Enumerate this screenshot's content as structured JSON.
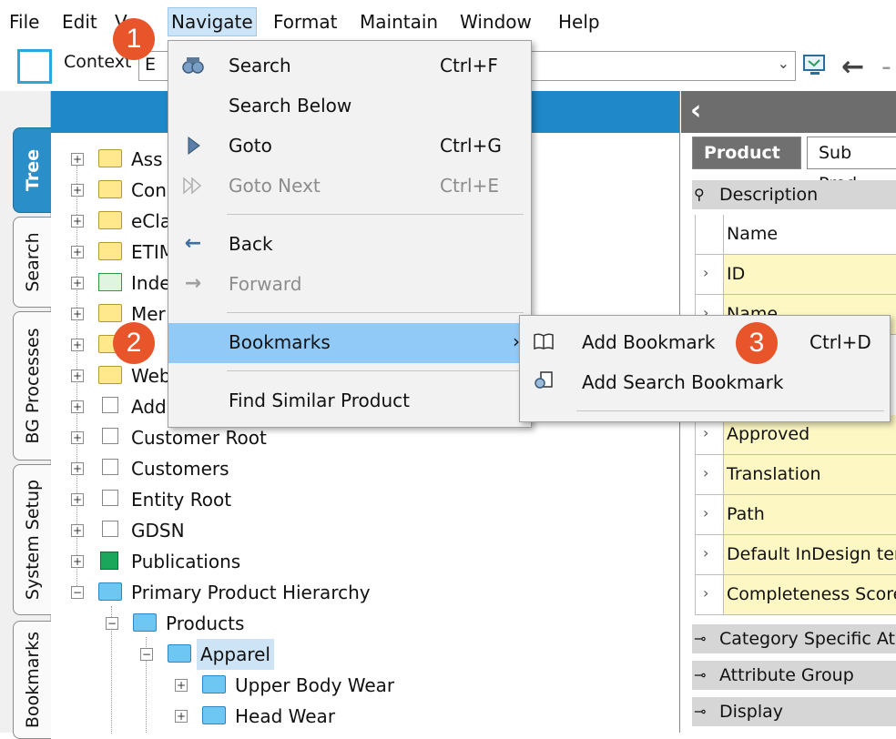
{
  "menubar": {
    "file": "File",
    "edit": "Edit",
    "view_partial": "V",
    "navigate": "Navigate",
    "format": "Format",
    "maintain": "Maintain",
    "window": "Window",
    "help": "Help"
  },
  "toolbar": {
    "context_label": "Context",
    "context_value": "E"
  },
  "side_tabs": [
    "Tree",
    "Search",
    "BG Processes",
    "System Setup",
    "Bookmarks"
  ],
  "tree": {
    "rows": [
      {
        "label": "Ass"
      },
      {
        "label": "Con"
      },
      {
        "label": "eCla"
      },
      {
        "label": "ETIM"
      },
      {
        "label": "Inde"
      },
      {
        "label": "Mer"
      },
      {
        "label": ""
      },
      {
        "label": "Web"
      },
      {
        "label": "Add"
      },
      {
        "label": "Customer Root"
      },
      {
        "label": "Customers"
      },
      {
        "label": "Entity Root"
      },
      {
        "label": "GDSN"
      },
      {
        "label": "Publications"
      },
      {
        "label": "Primary Product Hierarchy"
      },
      {
        "label": "Products"
      },
      {
        "label": "Apparel"
      },
      {
        "label": "Upper Body Wear"
      },
      {
        "label": "Head Wear"
      }
    ]
  },
  "navigate_menu": {
    "items": [
      {
        "label": "Search",
        "shortcut": "Ctrl+F",
        "icon": "binoculars-icon"
      },
      {
        "label": "Search Below",
        "shortcut": ""
      },
      {
        "label": "Goto",
        "shortcut": "Ctrl+G",
        "icon": "play-icon"
      },
      {
        "label": "Goto Next",
        "shortcut": "Ctrl+E",
        "icon": "fast-forward-icon"
      },
      {
        "label": "Back",
        "shortcut": "",
        "icon": "arrow-left-icon"
      },
      {
        "label": "Forward",
        "shortcut": "",
        "icon": "arrow-right-icon"
      },
      {
        "label": "Bookmarks",
        "shortcut": ""
      },
      {
        "label": "Find Similar Product",
        "shortcut": ""
      }
    ]
  },
  "bookmarks_submenu": {
    "items": [
      {
        "label": "Add Bookmark",
        "shortcut": "Ctrl+D",
        "icon": "book-icon"
      },
      {
        "label": "Add Search Bookmark",
        "shortcut": "",
        "icon": "search-bookmark-icon"
      }
    ]
  },
  "right_panel": {
    "tabs": [
      "Product",
      "Sub Prod"
    ],
    "description_section": "Description",
    "table_header": "Name",
    "rows": [
      "ID",
      "Name",
      "Approved",
      "Translation",
      "Path",
      "Default InDesign ter",
      "Completeness Score"
    ],
    "collapsed_sections": [
      "Category Specific At",
      "Attribute Group",
      "Display"
    ]
  },
  "badges": [
    "1",
    "2",
    "3"
  ],
  "colors": {
    "accent_blue": "#1e88c8",
    "menu_highlight": "#91c9f7",
    "badge_orange": "#e8552b",
    "attr_yellow": "#fdf7c3"
  }
}
